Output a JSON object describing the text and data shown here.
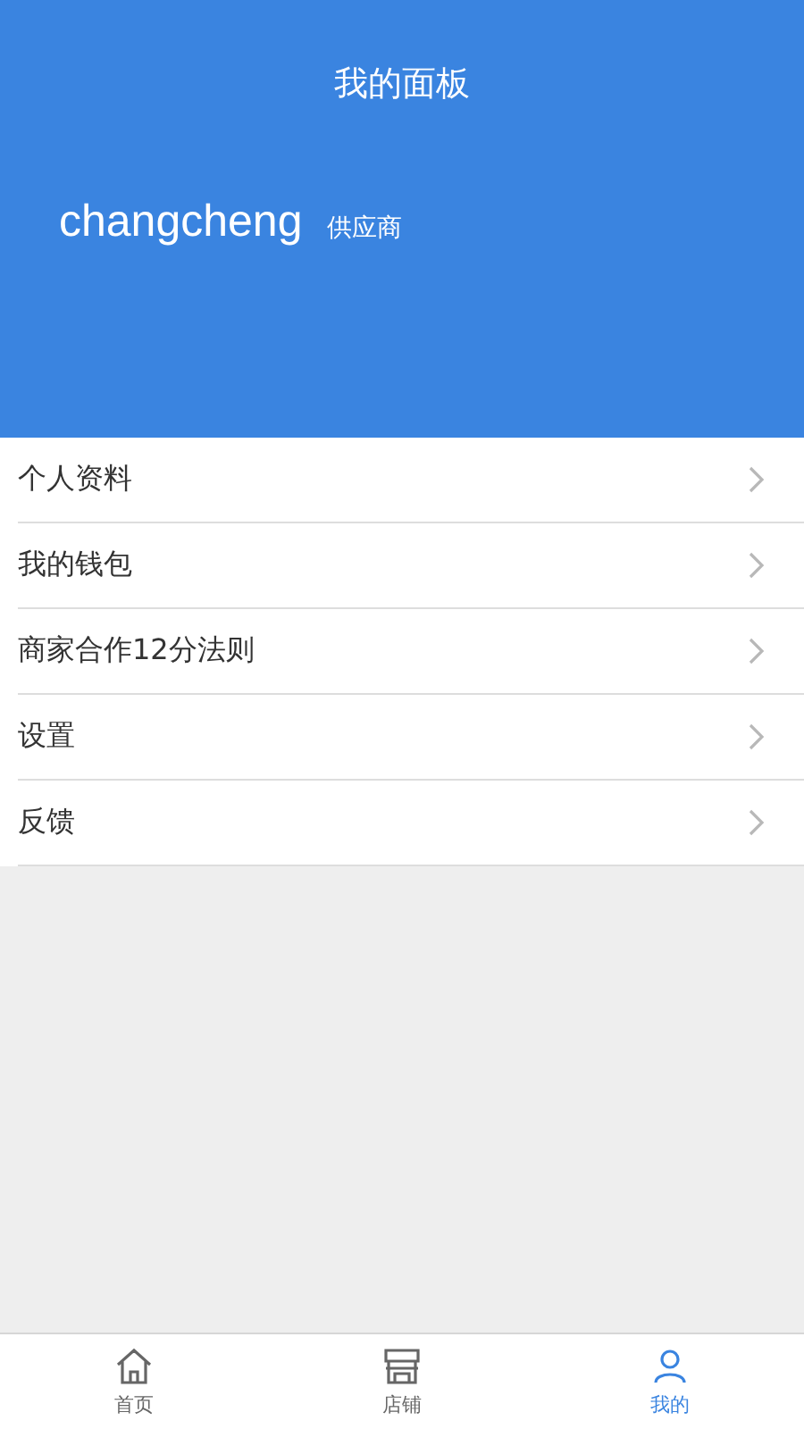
{
  "header": {
    "title": "我的面板",
    "username": "changcheng",
    "role": "供应商"
  },
  "menu": [
    {
      "label": "个人资料"
    },
    {
      "label": "我的钱包"
    },
    {
      "label": "商家合作12分法则"
    },
    {
      "label": "设置"
    },
    {
      "label": "反馈"
    }
  ],
  "tabs": [
    {
      "label": "首页",
      "kind": "home",
      "selected": false
    },
    {
      "label": "店铺",
      "kind": "shop",
      "selected": false
    },
    {
      "label": "我的",
      "kind": "me",
      "selected": true
    }
  ]
}
